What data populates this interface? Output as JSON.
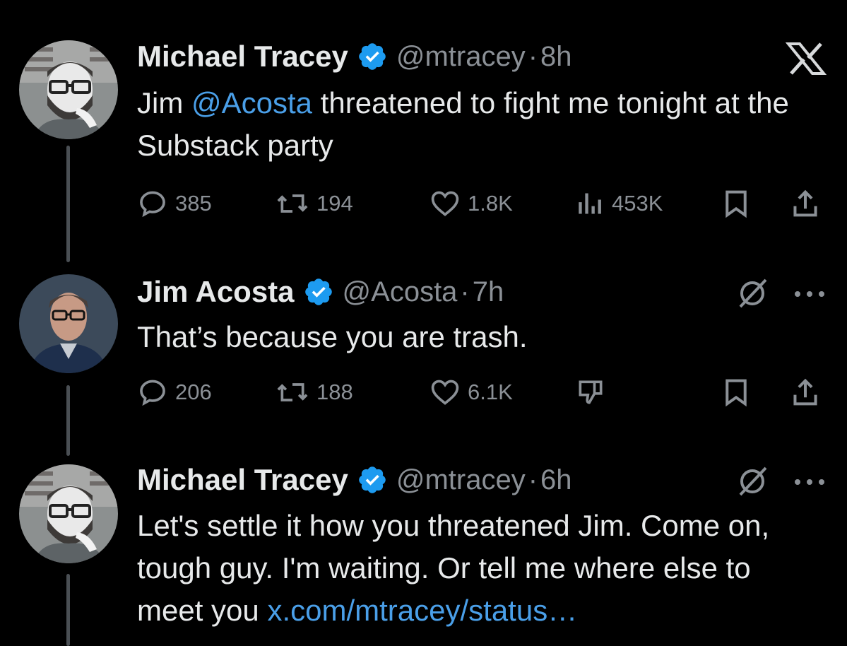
{
  "tweets": [
    {
      "name": "Michael Tracey",
      "handle": "@mtracey",
      "separator": "·",
      "time": "8h",
      "text_parts": {
        "before": "Jim ",
        "mention": "@Acosta",
        "after": " threatened to fight me tonight at the Substack party"
      },
      "replies": "385",
      "reposts": "194",
      "likes": "1.8K",
      "views": "453K",
      "top_icon": "x-logo-icon"
    },
    {
      "name": "Jim Acosta",
      "handle": "@Acosta",
      "separator": "·",
      "time": "7h",
      "text": "That’s because you are trash.",
      "replies": "206",
      "reposts": "188",
      "likes": "6.1K",
      "top_icon": "grok-icon"
    },
    {
      "name": "Michael Tracey",
      "handle": "@mtracey",
      "separator": "·",
      "time": "6h",
      "text_parts": {
        "before": "Let's settle it how you threatened Jim. Come on, tough guy. I'm waiting. Or tell me where else to meet you ",
        "link": "x.com/mtracey/status…"
      },
      "top_icon": "grok-icon"
    }
  ],
  "colors": {
    "background": "#000000",
    "text": "#e7e9ea",
    "secondary": "#8b9096",
    "link": "#4a9fe8",
    "verified": "#1d9bf0"
  }
}
